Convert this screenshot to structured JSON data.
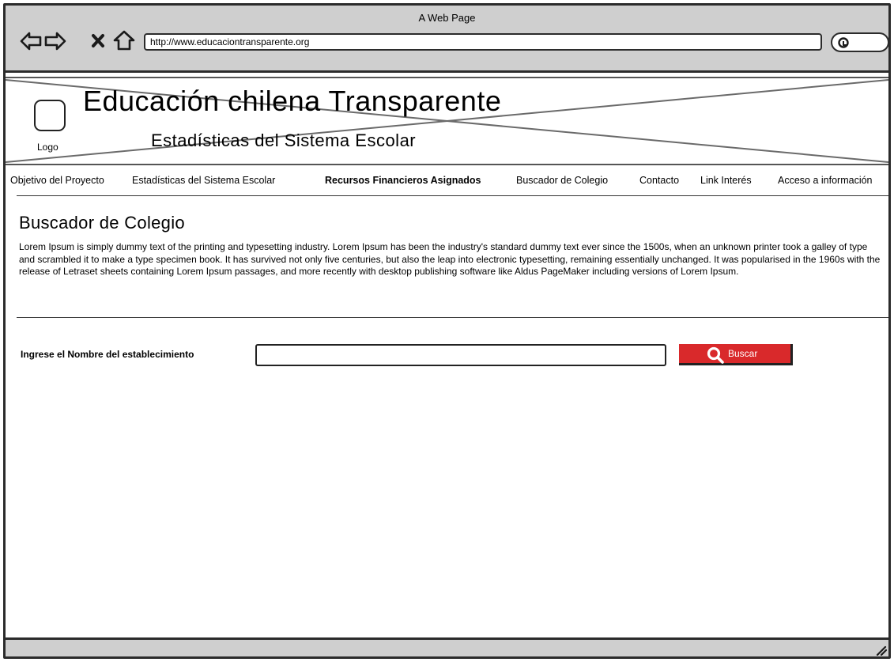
{
  "window": {
    "title": "A Web Page",
    "url": "http://www.educaciontransparente.org"
  },
  "icons": {
    "back": "back-arrow-icon",
    "forward": "forward-arrow-icon",
    "stop": "close-icon",
    "home": "home-icon",
    "search": "search-icon",
    "resize": "resize-grip-icon"
  },
  "header": {
    "logo_label": "Logo",
    "title": "Educación chilena Transparente",
    "subtitle": "Estadísticas del Sistema Escolar"
  },
  "nav": {
    "items": [
      {
        "label": "Objetivo del Proyecto",
        "bold": false
      },
      {
        "label": "Estadísticas del Sistema Escolar",
        "bold": false
      },
      {
        "label": "Recursos Financieros Asignados",
        "bold": true
      },
      {
        "label": "Buscador de Colegio",
        "bold": false
      },
      {
        "label": "Contacto",
        "bold": false
      },
      {
        "label": "Link Interés",
        "bold": false
      },
      {
        "label": "Acceso a información",
        "bold": false
      }
    ]
  },
  "main": {
    "title": "Buscador de Colegio",
    "body": "Lorem Ipsum is simply dummy text of the printing and typesetting industry. Lorem Ipsum has been the industry's standard dummy text ever since the 1500s, when an unknown printer took a galley of type and scrambled it to make a type specimen book. It has survived not only five centuries, but also the leap into electronic typesetting, remaining essentially unchanged. It was popularised in the 1960s with the release of Letraset sheets containing Lorem Ipsum passages, and more recently with desktop publishing software like Aldus PageMaker including versions of Lorem Ipsum."
  },
  "search": {
    "label": "Ingrese el Nombre del establecimiento",
    "value": "",
    "button_label": "Buscar"
  },
  "colors": {
    "chrome": "#cfcfcf",
    "border": "#2b2b2b",
    "accent": "#d9292b"
  }
}
